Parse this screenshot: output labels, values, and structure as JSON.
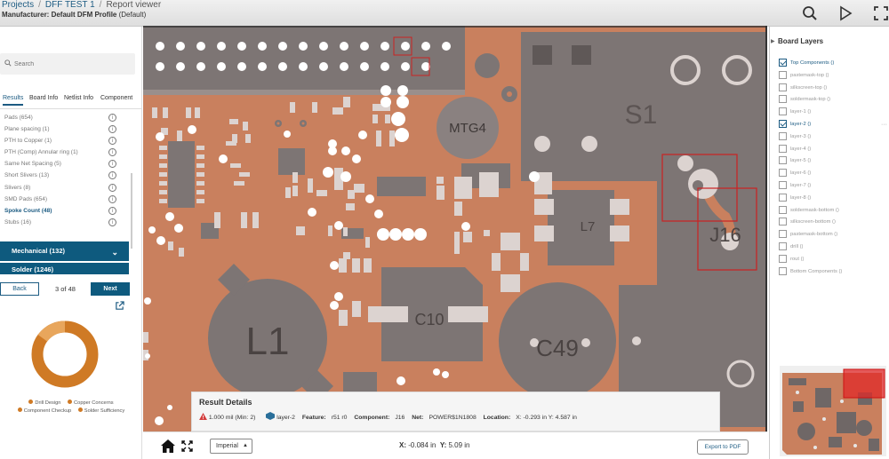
{
  "header": {
    "breadcrumb": [
      "Projects",
      "DFF TEST 1",
      "Report viewer"
    ],
    "manufacturer_label": "Manufacturer:",
    "manufacturer_value": "Default DFM Profile",
    "manufacturer_note": "(Default)"
  },
  "left": {
    "search_placeholder": "Search",
    "tabs": [
      "Results",
      "Board Info",
      "Netlist Info",
      "Component"
    ],
    "results": [
      "Pads (654)",
      "Plane spacing (1)",
      "PTH to Copper (1)",
      "PTH (Comp) Annular ring (1)",
      "Same Net Spacing (5)",
      "Short Slivers (13)",
      "Slivers (8)",
      "SMD Pads (654)",
      "Spoke Count (48)",
      "Stubs (16)"
    ],
    "active_result": 8,
    "categories": [
      "Mechanical (132)",
      "Solder (1246)"
    ],
    "back_label": "Back",
    "counter": "3 of 48",
    "next_label": "Next",
    "legend": [
      "Drill Design",
      "Copper Concerns",
      "Component Checkup",
      "Solder Sufficiency"
    ],
    "donut_color": "#cf7a25",
    "donut_highlight_color": "#e8a65c"
  },
  "result_details": {
    "title": "Result Details",
    "violation": "1.000 mil (Min: 2)",
    "layer": "layer-2",
    "feature_label": "Feature:",
    "feature_value": "r51 r0",
    "component_label": "Component:",
    "component_value": "J16",
    "net_label": "Net:",
    "net_value": "POWER$1N1808",
    "location_label": "Location:",
    "location_value": "X: -0.293 in Y: 4.587 in"
  },
  "bottom": {
    "unit": "Imperial",
    "x_label": "X:",
    "x_value": "-0.084 in",
    "y_label": "Y:",
    "y_value": "5.09 in",
    "export_label": "Export to PDF"
  },
  "board": {
    "labels": [
      "MTG4",
      "S1",
      "L7",
      "J16",
      "L1",
      "C10",
      "C49"
    ],
    "copper_color": "#c9805e",
    "component_color": "#7d7574",
    "highlight_color": "#cc2222"
  },
  "layers": {
    "title": "Board Layers",
    "items": [
      {
        "label": "Top Components ()",
        "checked": true
      },
      {
        "label": "pastemask-top ()",
        "checked": false
      },
      {
        "label": "silkscreen-top ()",
        "checked": false
      },
      {
        "label": "soldermask-top ()",
        "checked": false
      },
      {
        "label": "layer-1 ()",
        "checked": false
      },
      {
        "label": "layer-2 ()",
        "checked": true
      },
      {
        "label": "layer-3 ()",
        "checked": false
      },
      {
        "label": "layer-4 ()",
        "checked": false
      },
      {
        "label": "layer-5 ()",
        "checked": false
      },
      {
        "label": "layer-6 ()",
        "checked": false
      },
      {
        "label": "layer-7 ()",
        "checked": false
      },
      {
        "label": "layer-8 ()",
        "checked": false
      },
      {
        "label": "soldermask-bottom ()",
        "checked": false
      },
      {
        "label": "silkscreen-bottom ()",
        "checked": false
      },
      {
        "label": "pastemask-bottom ()",
        "checked": false
      },
      {
        "label": "drill ()",
        "checked": false
      },
      {
        "label": "rout ()",
        "checked": false
      },
      {
        "label": "Bottom Components ()",
        "checked": false
      }
    ]
  }
}
